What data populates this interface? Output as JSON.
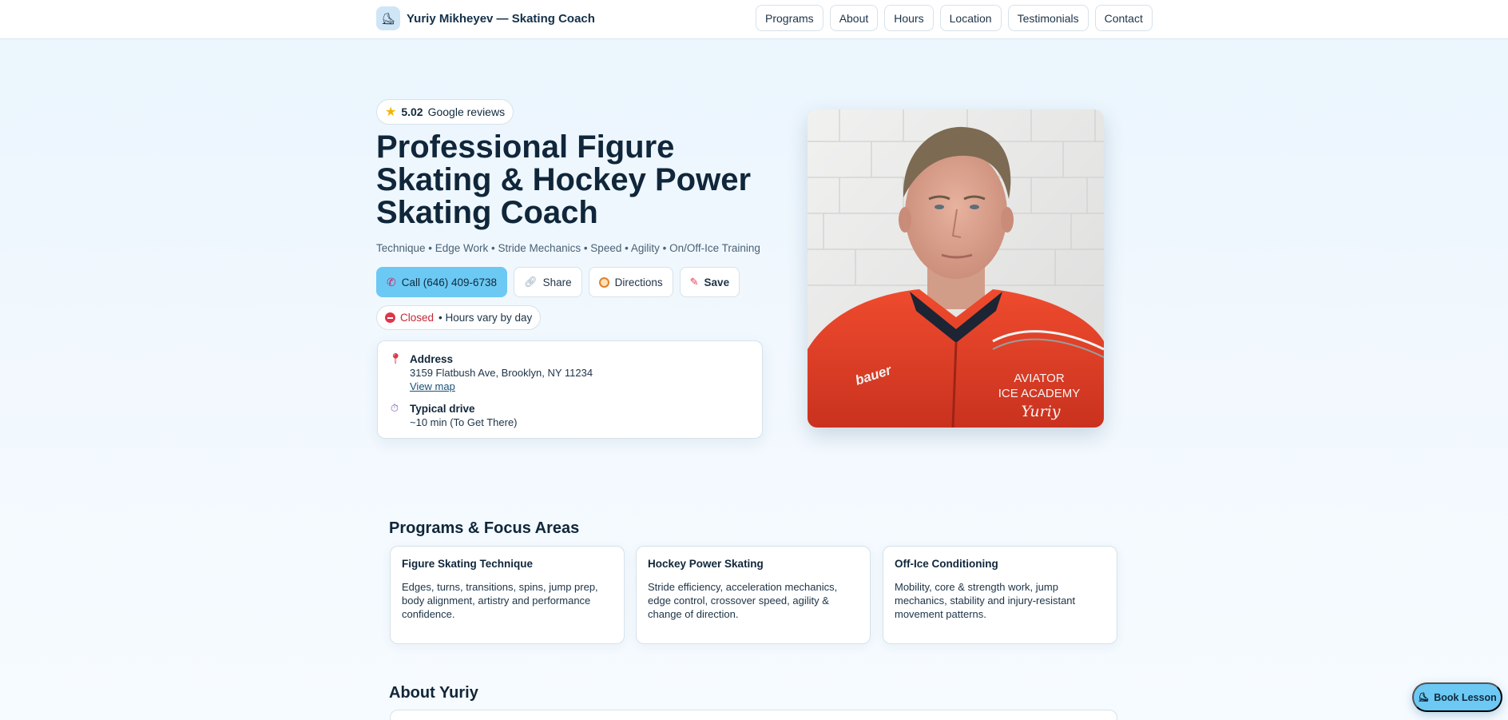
{
  "header": {
    "brand_logo_icon": "skate-icon",
    "brand_name": "Yuriy Mikheyev — Skating Coach",
    "nav": [
      "Programs",
      "About",
      "Hours",
      "Location",
      "Testimonials",
      "Contact"
    ]
  },
  "hero": {
    "rating": {
      "score": "5.02",
      "label": "Google reviews",
      "icon": "star-icon"
    },
    "title": "Professional Figure Skating & Hockey Power Skating Coach",
    "tagline": "Technique • Edge Work • Stride Mechanics • Speed • Agility • On/Off-Ice Training",
    "actions": {
      "call": "Call (646) 409-6738",
      "share": "Share",
      "directions": "Directions",
      "save": "Save"
    },
    "status": {
      "state": "Closed",
      "note": "• Hours vary by day"
    },
    "address": {
      "label": "Address",
      "value": "3159 Flatbush Ave, Brooklyn, NY 11234",
      "link": "View map"
    },
    "drive": {
      "label": "Typical drive",
      "value": "~10 min (To Get There)"
    },
    "portrait": {
      "jacket_brand": "Bauer",
      "jacket_text_1": "AVIATOR",
      "jacket_text_2": "ICE ACADEMY",
      "jacket_text_3": "Yuriy"
    }
  },
  "programs": {
    "title": "Programs & Focus Areas",
    "items": [
      {
        "title": "Figure Skating Technique",
        "desc": "Edges, turns, transitions, spins, jump prep, body alignment, artistry and performance confidence."
      },
      {
        "title": "Hockey Power Skating",
        "desc": "Stride efficiency, acceleration mechanics, edge control, crossover speed, agility & change of direction."
      },
      {
        "title": "Off-Ice Conditioning",
        "desc": "Mobility, core & strength work, jump mechanics, stability and injury-resistant movement patterns."
      }
    ]
  },
  "about": {
    "title": "About Yuriy"
  },
  "floating": {
    "book": "Book Lesson"
  },
  "colors": {
    "accent": "#6cc9f3",
    "closed": "#c62836",
    "heading": "#10263a"
  }
}
